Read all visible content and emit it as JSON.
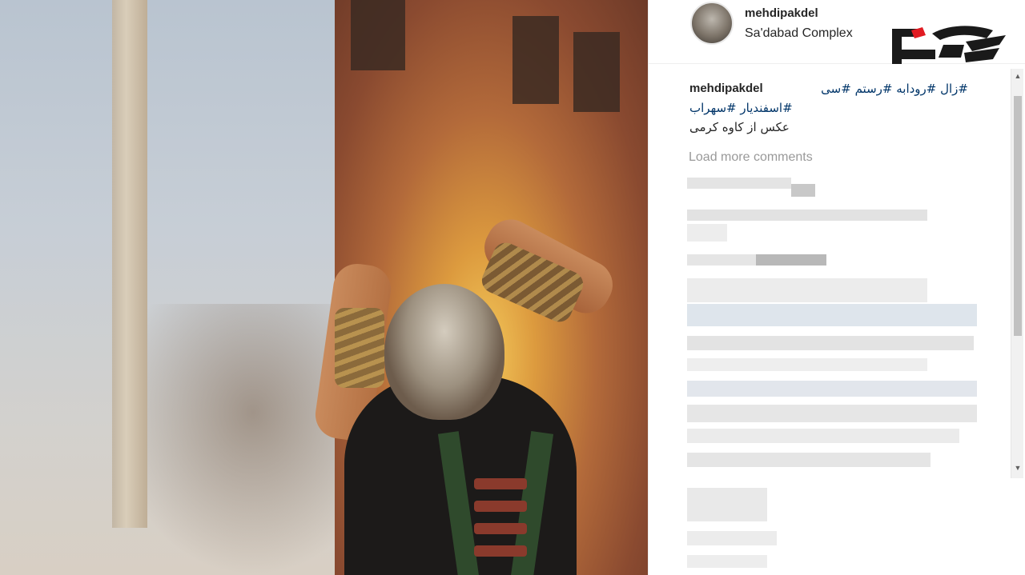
{
  "post": {
    "username": "mehdipakdel",
    "location": "Sa'dabad Complex"
  },
  "caption": {
    "username": "mehdipakdel",
    "tags_line1": "#زال #رودابه #رستم #سی",
    "tags_line2": "#اسفندیار #سهراب",
    "credit": "عکس از کاوه کرمی"
  },
  "comments": {
    "load_more_label": "Load more comments"
  },
  "scrollbar": {
    "up_icon": "▲",
    "down_icon": "▼"
  },
  "colors": {
    "hashtag": "#003569",
    "muted": "#999999",
    "logo_red": "#e11b22",
    "logo_dark": "#1a1a1a"
  },
  "icons": [
    "avatar",
    "site-logo",
    "scroll-up-icon",
    "scroll-down-icon"
  ]
}
